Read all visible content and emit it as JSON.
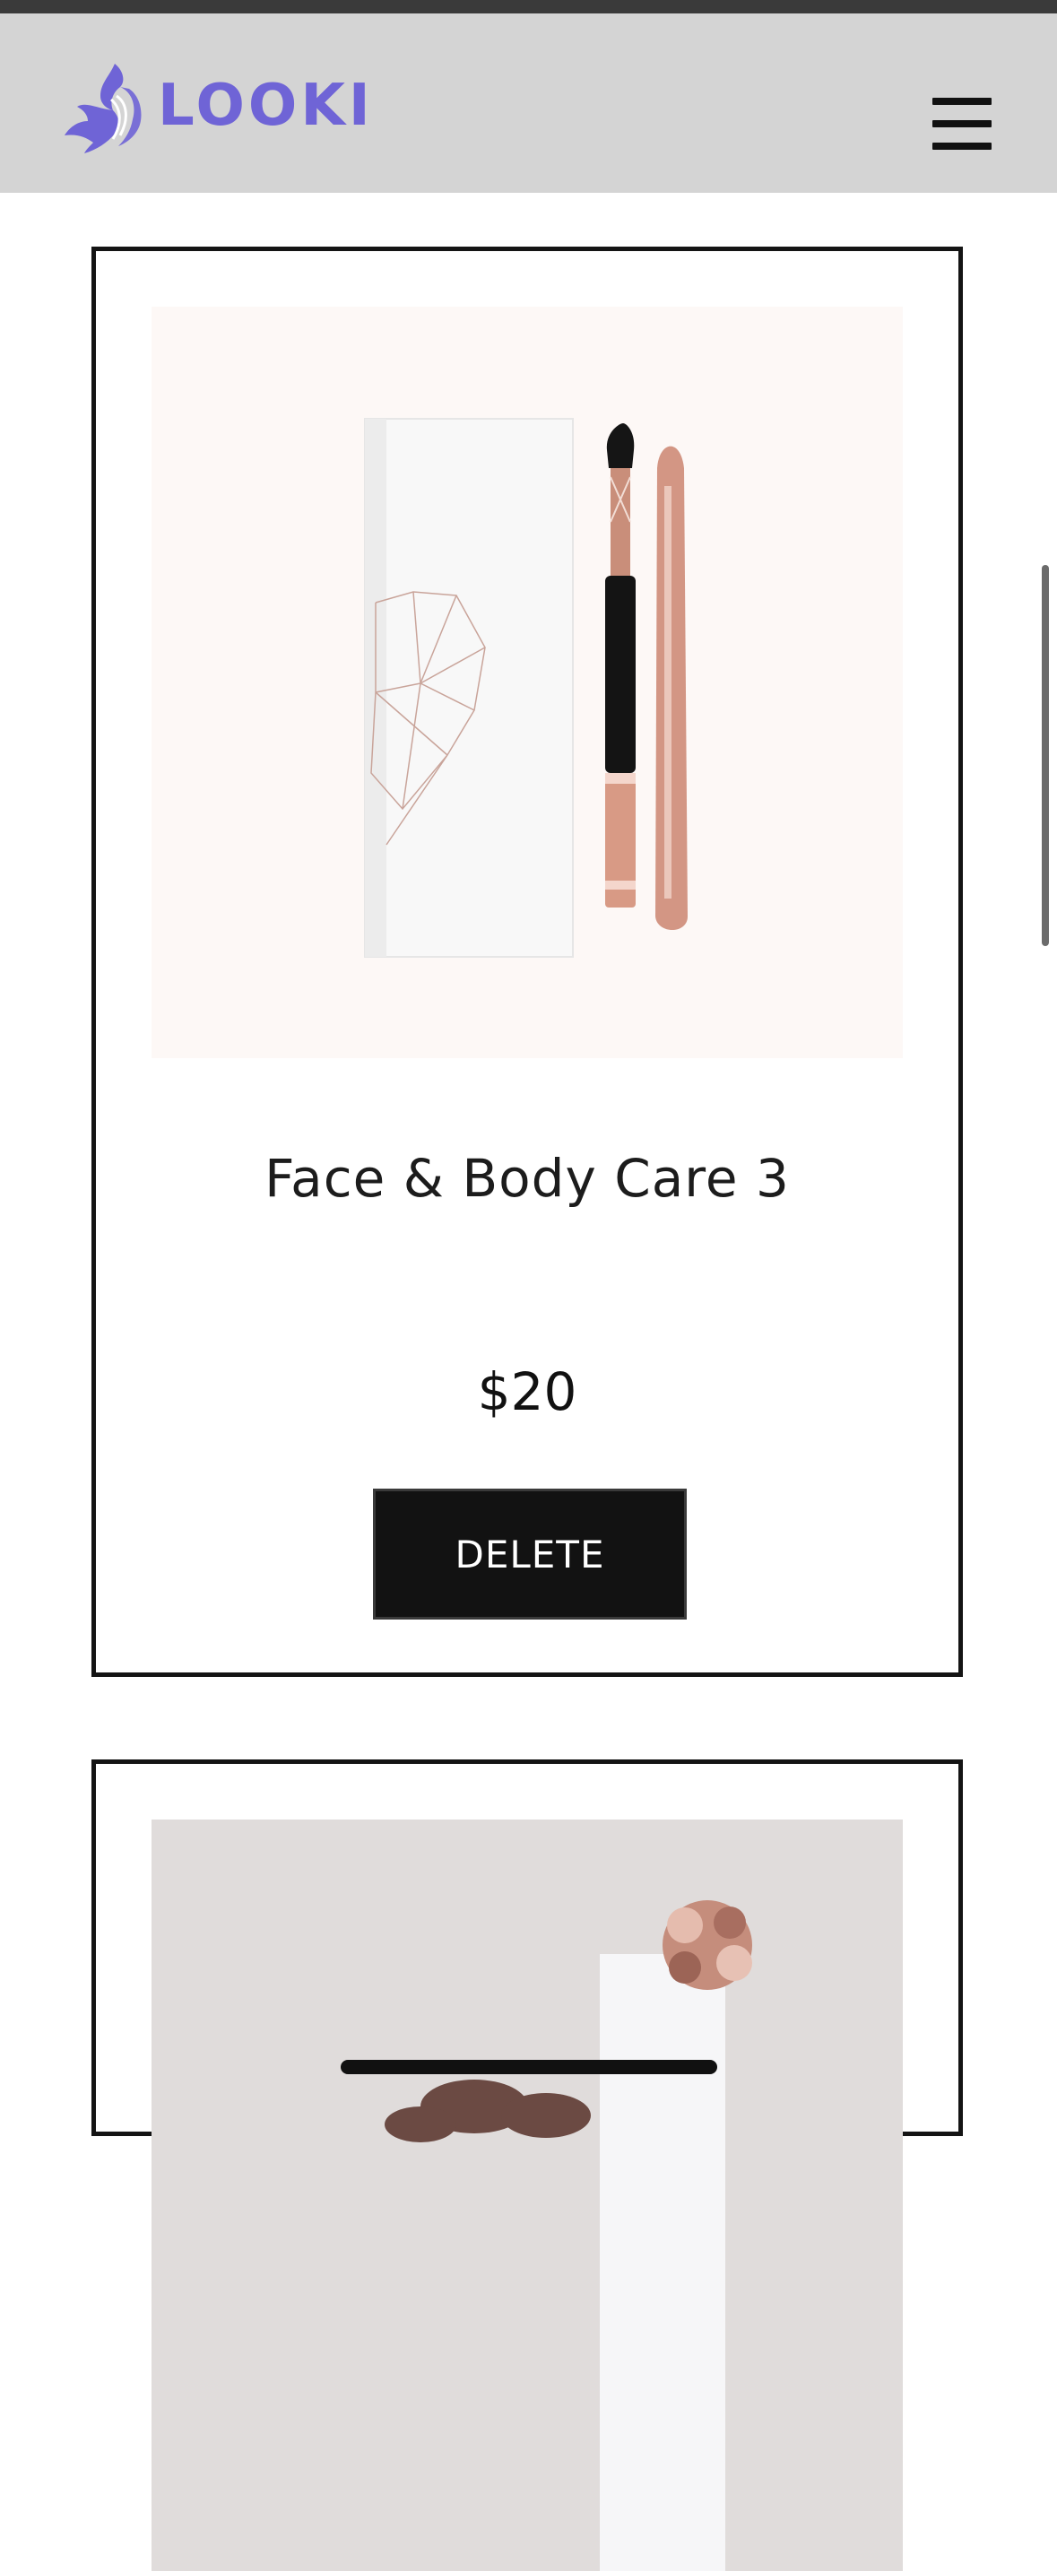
{
  "header": {
    "logo_text": "LOOKI",
    "brand_color": "#6f64d6",
    "menu_icon": "hamburger-menu-icon"
  },
  "products": [
    {
      "title": "Face & Body Care 3",
      "price": "$20",
      "delete_label": "DELETE",
      "image": "rose-gold makeup brush with white geometric box"
    },
    {
      "image": "makeup brushes with rose-gold gift bow"
    }
  ]
}
